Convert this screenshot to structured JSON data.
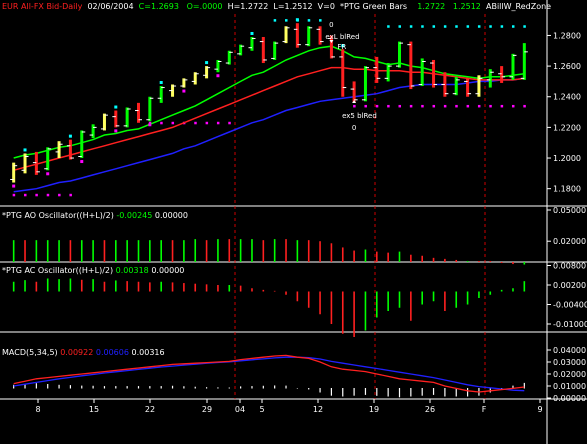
{
  "header": {
    "symbol": "EUR All-FX Bid-Daily",
    "date": "02/06/2004",
    "close": "C=1.2693",
    "open": "O=.0000",
    "high": "H=1.2722",
    "low": "L=1.2512",
    "volume": "V=0",
    "indicator": "*PTG Green Bars",
    "ind_val1": "1.2722",
    "ind_val2": "1.2512",
    "ind_name2": "ABillW_RedZone"
  },
  "colors": {
    "background": "#000000",
    "green": "#00ff00",
    "red": "#ff2020",
    "blue": "#2020ff",
    "cyan": "#00ffff",
    "magenta": "#ff00ff",
    "grid": "#ff0000",
    "axis_text": "#ffffff"
  },
  "annotations": {
    "top_zero": "0",
    "exl_label": "exL blRed",
    "fr_label": "FR",
    "exs_label": "ex5 blRed",
    "bottom_zero": "0"
  },
  "panels": {
    "ao": {
      "label": "*PTG AO Oscillator((H+L)/2)",
      "v1": "-0.00245",
      "v2": "0.00000"
    },
    "ac": {
      "label": "*PTG AC Oscillator((H+L)/2)",
      "v1": "0.00318",
      "v2": "0.00000"
    },
    "macd": {
      "label": "MACD(5,34,5)",
      "v1": "0.00922",
      "v2": "0.00606",
      "v3": "0.00316"
    }
  },
  "chart_data": [
    {
      "type": "ohlc",
      "name": "price",
      "y_tick_labels": [
        "1.2800",
        "1.2600",
        "1.2400",
        "1.2200",
        "1.2000",
        "1.1800"
      ],
      "ylim": [
        1.17,
        1.294
      ],
      "x_tick_labels": [
        "8",
        "15",
        "22",
        "29",
        "04",
        "5",
        "12",
        "19",
        "26",
        "F",
        "9"
      ],
      "bars": [
        [
          1.186,
          1.197,
          1.184,
          1.195,
          "Y"
        ],
        [
          1.192,
          1.203,
          1.19,
          1.201,
          "Y"
        ],
        [
          1.197,
          1.204,
          1.189,
          1.191,
          "R"
        ],
        [
          1.193,
          1.207,
          1.192,
          1.206,
          "G"
        ],
        [
          1.204,
          1.211,
          1.2,
          1.209,
          "Y"
        ],
        [
          1.208,
          1.212,
          1.199,
          1.2,
          "R"
        ],
        [
          1.201,
          1.218,
          1.2,
          1.217,
          "G"
        ],
        [
          1.215,
          1.222,
          1.213,
          1.22,
          "G"
        ],
        [
          1.219,
          1.229,
          1.218,
          1.228,
          "Y"
        ],
        [
          1.227,
          1.231,
          1.22,
          1.221,
          "R"
        ],
        [
          1.221,
          1.233,
          1.22,
          1.232,
          "G"
        ],
        [
          1.231,
          1.236,
          1.223,
          1.225,
          "R"
        ],
        [
          1.225,
          1.24,
          1.224,
          1.239,
          "G"
        ],
        [
          1.239,
          1.247,
          1.236,
          1.246,
          "G"
        ],
        [
          1.244,
          1.248,
          1.24,
          1.247,
          "Y"
        ],
        [
          1.247,
          1.252,
          1.246,
          1.251,
          "Y"
        ],
        [
          1.25,
          1.256,
          1.248,
          1.255,
          "Y"
        ],
        [
          1.254,
          1.26,
          1.252,
          1.259,
          "Y"
        ],
        [
          1.258,
          1.264,
          1.256,
          1.263,
          "G"
        ],
        [
          1.262,
          1.27,
          1.261,
          1.269,
          "G"
        ],
        [
          1.268,
          1.274,
          1.267,
          1.273,
          "G"
        ],
        [
          1.272,
          1.279,
          1.27,
          1.278,
          "G"
        ],
        [
          1.276,
          1.279,
          1.262,
          1.264,
          "R"
        ],
        [
          1.265,
          1.276,
          1.264,
          1.275,
          "G"
        ],
        [
          1.276,
          1.286,
          1.275,
          1.285,
          "Y"
        ],
        [
          1.284,
          1.288,
          1.272,
          1.274,
          "R"
        ],
        [
          1.274,
          1.286,
          1.273,
          1.285,
          "G"
        ],
        [
          1.284,
          1.286,
          1.274,
          1.276,
          "R"
        ],
        [
          1.278,
          1.28,
          1.265,
          1.266,
          "R"
        ],
        [
          1.266,
          1.271,
          1.24,
          1.246,
          "R"
        ],
        [
          1.245,
          1.25,
          1.236,
          1.238,
          "R"
        ],
        [
          1.238,
          1.26,
          1.237,
          1.259,
          "G"
        ],
        [
          1.259,
          1.266,
          1.249,
          1.252,
          "R"
        ],
        [
          1.252,
          1.262,
          1.25,
          1.26,
          "G"
        ],
        [
          1.26,
          1.276,
          1.259,
          1.275,
          "G"
        ],
        [
          1.274,
          1.276,
          1.245,
          1.247,
          "R"
        ],
        [
          1.248,
          1.265,
          1.247,
          1.263,
          "G"
        ],
        [
          1.262,
          1.264,
          1.246,
          1.248,
          "R"
        ],
        [
          1.248,
          1.256,
          1.24,
          1.242,
          "R"
        ],
        [
          1.242,
          1.253,
          1.241,
          1.251,
          "G"
        ],
        [
          1.25,
          1.252,
          1.24,
          1.242,
          "R"
        ],
        [
          1.242,
          1.254,
          1.24,
          1.252,
          "Y"
        ],
        [
          1.251,
          1.258,
          1.246,
          1.256,
          "G"
        ],
        [
          1.255,
          1.26,
          1.249,
          1.253,
          "R"
        ],
        [
          1.253,
          1.268,
          1.251,
          1.267,
          "G"
        ],
        [
          1.252,
          1.275,
          1.251,
          1.2693,
          "G"
        ]
      ],
      "green_ma": [
        1.2,
        1.202,
        1.203,
        1.205,
        1.207,
        1.208,
        1.21,
        1.212,
        1.215,
        1.216,
        1.218,
        1.219,
        1.222,
        1.225,
        1.228,
        1.231,
        1.234,
        1.238,
        1.242,
        1.246,
        1.25,
        1.254,
        1.256,
        1.26,
        1.264,
        1.267,
        1.27,
        1.272,
        1.273,
        1.27,
        1.266,
        1.265,
        1.263,
        1.261,
        1.262,
        1.26,
        1.259,
        1.257,
        1.255,
        1.254,
        1.253,
        1.252,
        1.253,
        1.253,
        1.254,
        1.255
      ],
      "red_ma": [
        1.192,
        1.194,
        1.196,
        1.198,
        1.2,
        1.202,
        1.204,
        1.206,
        1.208,
        1.21,
        1.212,
        1.214,
        1.216,
        1.218,
        1.22,
        1.223,
        1.226,
        1.229,
        1.232,
        1.235,
        1.238,
        1.241,
        1.244,
        1.247,
        1.25,
        1.253,
        1.255,
        1.257,
        1.259,
        1.259,
        1.258,
        1.258,
        1.257,
        1.257,
        1.257,
        1.256,
        1.256,
        1.255,
        1.254,
        1.253,
        1.252,
        1.251,
        1.251,
        1.251,
        1.251,
        1.252
      ],
      "blue_ma": [
        1.178,
        1.179,
        1.18,
        1.182,
        1.184,
        1.185,
        1.187,
        1.189,
        1.191,
        1.193,
        1.195,
        1.197,
        1.199,
        1.201,
        1.203,
        1.206,
        1.208,
        1.211,
        1.214,
        1.217,
        1.22,
        1.223,
        1.225,
        1.228,
        1.231,
        1.233,
        1.235,
        1.237,
        1.238,
        1.239,
        1.24,
        1.241,
        1.242,
        1.244,
        1.246,
        1.247,
        1.248,
        1.248,
        1.248,
        1.248,
        1.249,
        1.25,
        1.25,
        1.251,
        1.251,
        1.252
      ],
      "cyan_dots_level": 1.286,
      "magenta_dots_level": 1.234
    },
    {
      "type": "bar",
      "name": "ao",
      "y_tick_labels": [
        "0.05000",
        "0.02000"
      ],
      "values": [
        0.021,
        0.021,
        0.021,
        0.021,
        0.021,
        0.021,
        0.021,
        0.021,
        0.021,
        0.021,
        0.021,
        0.021,
        0.021,
        0.021,
        0.021,
        0.021,
        0.022,
        0.021,
        0.022,
        0.022,
        0.022,
        0.022,
        0.021,
        0.022,
        0.022,
        0.021,
        0.021,
        0.02,
        0.018,
        0.014,
        0.011,
        0.012,
        0.01,
        0.009,
        0.01,
        0.007,
        0.006,
        0.004,
        0.003,
        0.002,
        0.001,
        0.001,
        0.001,
        -0.001,
        -0.002,
        -0.00245
      ],
      "colors": [
        "G",
        "R",
        "G",
        "G",
        "G",
        "R",
        "G",
        "G",
        "R",
        "G",
        "G",
        "G",
        "G",
        "G",
        "R",
        "G",
        "G",
        "R",
        "G",
        "R",
        "G",
        "G",
        "R",
        "G",
        "R",
        "G",
        "R",
        "R",
        "R",
        "R",
        "R",
        "G",
        "R",
        "R",
        "G",
        "R",
        "R",
        "R",
        "R",
        "R",
        "G",
        "R",
        "R",
        "R",
        "R",
        "G"
      ]
    },
    {
      "type": "bar",
      "name": "ac",
      "y_tick_labels": [
        "0.00800",
        "0.00200",
        "-0.00400",
        "-0.01000"
      ],
      "values": [
        0.003,
        0.0035,
        0.003,
        0.004,
        0.0038,
        0.004,
        0.0036,
        0.0038,
        0.003,
        0.0034,
        0.0032,
        0.003,
        0.0028,
        0.003,
        0.0028,
        0.0026,
        0.0024,
        0.0022,
        0.002,
        0.002,
        0.0018,
        0.001,
        0.0005,
        0.0002,
        -0.001,
        -0.003,
        -0.005,
        -0.007,
        -0.01,
        -0.013,
        -0.014,
        -0.012,
        -0.008,
        -0.006,
        -0.005,
        -0.009,
        -0.004,
        -0.003,
        -0.006,
        -0.005,
        -0.004,
        -0.002,
        -0.001,
        0.0005,
        0.001,
        0.00318
      ],
      "colors": [
        "G",
        "G",
        "R",
        "G",
        "G",
        "G",
        "R",
        "G",
        "R",
        "G",
        "R",
        "R",
        "R",
        "G",
        "R",
        "R",
        "R",
        "R",
        "R",
        "G",
        "R",
        "R",
        "R",
        "R",
        "R",
        "R",
        "R",
        "R",
        "R",
        "R",
        "R",
        "G",
        "G",
        "G",
        "G",
        "R",
        "G",
        "G",
        "R",
        "G",
        "G",
        "G",
        "G",
        "G",
        "G",
        "G"
      ]
    },
    {
      "type": "line",
      "name": "macd",
      "y_tick_labels": [
        "0.04000",
        "0.03000",
        "0.02000",
        "0.01000",
        "0.00000"
      ],
      "red": [
        0.012,
        0.014,
        0.016,
        0.017,
        0.018,
        0.019,
        0.02,
        0.021,
        0.022,
        0.023,
        0.024,
        0.025,
        0.026,
        0.027,
        0.028,
        0.0285,
        0.029,
        0.0295,
        0.03,
        0.0305,
        0.032,
        0.033,
        0.034,
        0.035,
        0.0355,
        0.034,
        0.033,
        0.03,
        0.026,
        0.024,
        0.023,
        0.022,
        0.02,
        0.018,
        0.016,
        0.015,
        0.014,
        0.013,
        0.01,
        0.008,
        0.006,
        0.005,
        0.006,
        0.007,
        0.008,
        0.0092
      ],
      "blue": [
        0.01,
        0.0115,
        0.013,
        0.0145,
        0.016,
        0.0172,
        0.0185,
        0.0196,
        0.0208,
        0.0218,
        0.0228,
        0.0238,
        0.0248,
        0.0258,
        0.0266,
        0.0274,
        0.0282,
        0.029,
        0.0296,
        0.0302,
        0.031,
        0.0318,
        0.0326,
        0.0334,
        0.034,
        0.034,
        0.0336,
        0.0325,
        0.0305,
        0.029,
        0.0275,
        0.026,
        0.0246,
        0.023,
        0.0215,
        0.02,
        0.0185,
        0.017,
        0.015,
        0.013,
        0.011,
        0.0095,
        0.0085,
        0.0075,
        0.0065,
        0.0061
      ],
      "hist": [
        0.002,
        0.0025,
        0.003,
        0.0025,
        0.002,
        0.0018,
        0.0015,
        0.0014,
        0.0012,
        0.0012,
        0.0012,
        0.0012,
        0.0012,
        0.0012,
        0.0014,
        0.0011,
        0.0008,
        0.0005,
        0.0004,
        0.0003,
        0.001,
        0.0012,
        0.0014,
        0.0016,
        0.0015,
        0.0,
        -0.0006,
        -0.0025,
        -0.0045,
        -0.005,
        -0.0045,
        -0.004,
        -0.0046,
        -0.005,
        -0.0055,
        -0.005,
        -0.0045,
        -0.004,
        -0.005,
        -0.005,
        -0.005,
        -0.0045,
        -0.0025,
        -0.0005,
        0.0015,
        0.0032
      ]
    }
  ]
}
